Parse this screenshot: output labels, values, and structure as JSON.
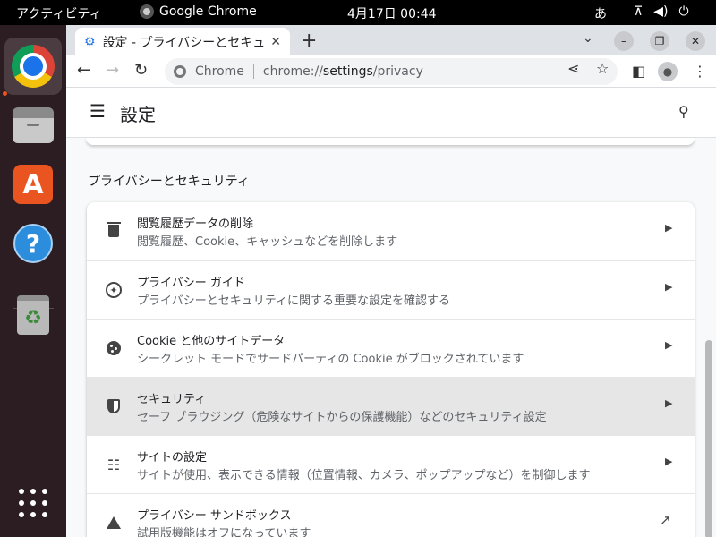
{
  "topbar": {
    "activities": "アクティビティ",
    "app_name": "Google Chrome",
    "clock": "4月17日  00:44",
    "ime": "あ"
  },
  "dock": {
    "items": [
      "chrome-icon",
      "files-icon",
      "app-store-icon",
      "help-icon",
      "trash-icon",
      "app-grid-icon"
    ]
  },
  "tab": {
    "title": "設定 - プライバシーとセキュ",
    "close": "✕"
  },
  "toolbar": {
    "scheme_label": "Chrome",
    "url_pre": "chrome://",
    "url_host": "settings",
    "url_post": "/privacy"
  },
  "settings": {
    "title": "設定",
    "section_title": "プライバシーとセキュリティ",
    "rows": [
      {
        "label": "閲覧履歴データの削除",
        "sub": "閲覧履歴、Cookie、キャッシュなどを削除します",
        "icon": "trash-icon"
      },
      {
        "label": "プライバシー ガイド",
        "sub": "プライバシーとセキュリティに関する重要な設定を確認する",
        "icon": "compass-icon"
      },
      {
        "label": "Cookie と他のサイトデータ",
        "sub": "シークレット モードでサードパーティの Cookie がブロックされています",
        "icon": "cookie-icon"
      },
      {
        "label": "セキュリティ",
        "sub": "セーフ ブラウジング（危険なサイトからの保護機能）などのセキュリティ設定",
        "icon": "shield-icon"
      },
      {
        "label": "サイトの設定",
        "sub": "サイトが使用、表示できる情報（位置情報、カメラ、ポップアップなど）を制御します",
        "icon": "tune-icon"
      },
      {
        "label": "プライバシー サンドボックス",
        "sub": "試用版機能はオフになっています",
        "icon": "flask-icon"
      }
    ]
  }
}
